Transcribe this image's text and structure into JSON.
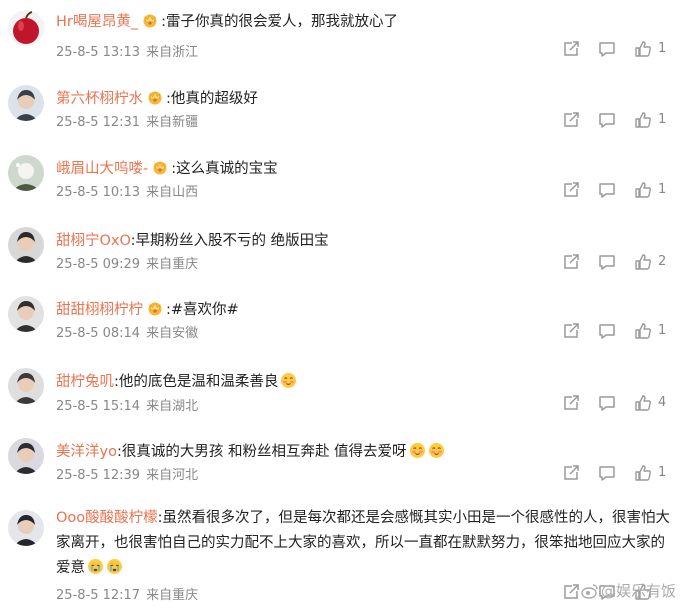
{
  "comments": [
    {
      "user": "Hr喝屋昂黄_",
      "badge": true,
      "text": ":雷子你真的很会爱人，那我就放心了",
      "emoji": 0,
      "date": "25-8-5 13:13",
      "location": "来自浙江",
      "likes": "1"
    },
    {
      "user": "第六杯栩柠水",
      "badge": true,
      "text": ":他真的超级好",
      "emoji": 0,
      "date": "25-8-5 12:31",
      "location": "来自新疆",
      "likes": "1"
    },
    {
      "user": "峨眉山大呜喽-",
      "badge": true,
      "text": ":这么真诚的宝宝",
      "emoji": 0,
      "date": "25-8-5 10:13",
      "location": "来自山西",
      "likes": "1"
    },
    {
      "user": "甜栩宁OxO",
      "badge": false,
      "text": ":早期粉丝入股不亏的 绝版田宝",
      "emoji": 0,
      "date": "25-8-5 09:29",
      "location": "来自重庆",
      "likes": "2"
    },
    {
      "user": "甜甜栩栩柠柠",
      "badge": true,
      "text": ":#喜欢你#",
      "emoji": 0,
      "date": "25-8-5 08:14",
      "location": "来自安徽",
      "likes": "1"
    },
    {
      "user": "甜柠兔叽",
      "badge": false,
      "text": ":他的底色是温和温柔善良",
      "emoji": 1,
      "date": "25-8-5 15:14",
      "location": "来自湖北",
      "likes": "4"
    },
    {
      "user": "美洋洋yo",
      "badge": false,
      "text": ":很真诚的大男孩 和粉丝相互奔赴 值得去爱呀",
      "emoji": 2,
      "date": "25-8-5 12:39",
      "location": "来自河北",
      "likes": "1"
    },
    {
      "user": "Ooo酸酸酸柠檬",
      "badge": false,
      "text": ":虽然看很多次了，但是每次都还是会感慨其实小田是一个很感性的人，很害怕大家离开，也很害怕自己的实力配不上大家的喜欢，所以一直都在默默努力，很笨拙地回应大家的爱意",
      "emoji": 2,
      "date": "25-8-5 12:17",
      "location": "来自重庆",
      "likes": ""
    }
  ],
  "watermark": "@娱乐有饭",
  "colors": {
    "username": "#eb7350",
    "meta": "#888888",
    "icon": "#9a9a9a"
  }
}
